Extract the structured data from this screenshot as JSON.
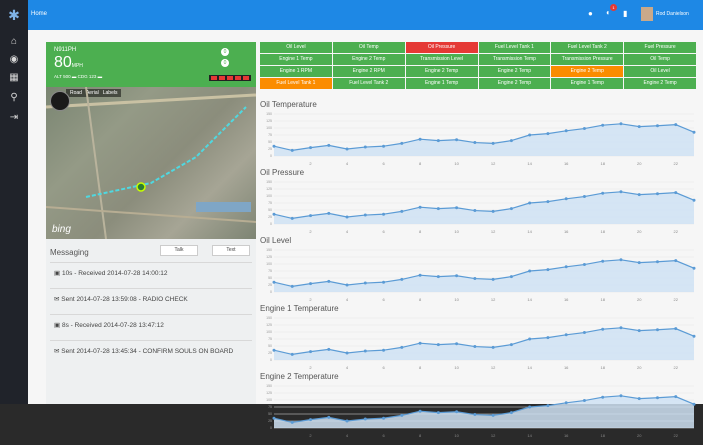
{
  "nav": {
    "home_label": "Home",
    "user_name": "Rod Danielson",
    "notif_count": "1"
  },
  "aircraft": {
    "tail": "N911PH",
    "speed": "80",
    "speed_unit": "MPH",
    "alt_line": "ALT 500 ▬ CDG 123 ▬",
    "stepper_top": "0",
    "stepper_bottom": "0"
  },
  "map": {
    "types": [
      "Road",
      "Aerial",
      "Labels"
    ],
    "brand": "bing"
  },
  "messaging": {
    "title": "Messaging",
    "talk_label": "Talk",
    "text_label": "Text",
    "items": [
      "10s - Received 2014-07-28 14:00:12",
      "Sent 2014-07-28 13:59:08 - RADIO CHECK",
      "8s - Received 2014-07-28 13:47:12",
      "Sent 2014-07-28 13:45:34 - CONFIRM SOULS ON BOARD"
    ]
  },
  "sensors": [
    {
      "label": "Oil Level",
      "status": "ok"
    },
    {
      "label": "Oil Temp",
      "status": "ok"
    },
    {
      "label": "Oil Pressure",
      "status": "alarm"
    },
    {
      "label": "Fuel Level Tank 1",
      "status": "ok"
    },
    {
      "label": "Fuel Level Tank 2",
      "status": "ok"
    },
    {
      "label": "Fuel Pressure",
      "status": "ok"
    },
    {
      "label": "Engine 1 Temp",
      "status": "ok"
    },
    {
      "label": "Engine 2 Temp",
      "status": "ok"
    },
    {
      "label": "Transmission Level",
      "status": "ok"
    },
    {
      "label": "Transmission Temp",
      "status": "ok"
    },
    {
      "label": "Transmission Pressure",
      "status": "ok"
    },
    {
      "label": "Oil Temp",
      "status": "ok"
    },
    {
      "label": "Engine 1 RPM",
      "status": "ok"
    },
    {
      "label": "Engine 2 RPM",
      "status": "ok"
    },
    {
      "label": "Engine 2 Temp",
      "status": "ok"
    },
    {
      "label": "Engine 2 Temp",
      "status": "ok"
    },
    {
      "label": "Engine 2 Temp",
      "status": "warn"
    },
    {
      "label": "Oil Level",
      "status": "ok"
    },
    {
      "label": "Fuel Level Tank 1",
      "status": "warn"
    },
    {
      "label": "Fuel Level Tank 2",
      "status": "ok"
    },
    {
      "label": "Engine 1 Temp",
      "status": "ok"
    },
    {
      "label": "Engine 2 Temp",
      "status": "ok"
    },
    {
      "label": "Engine 1 Temp",
      "status": "ok"
    },
    {
      "label": "Engine 2 Temp",
      "status": "ok"
    }
  ],
  "colors": {
    "ok": "#4caf50",
    "alarm": "#e53935",
    "warn": "#fb8c00",
    "line": "#5b9bd5",
    "fill": "#cfe2f3",
    "topbar": "#1e88e5"
  },
  "chart_data": [
    {
      "type": "area",
      "title": "Oil Temperature",
      "x": [
        0,
        1,
        2,
        3,
        4,
        5,
        6,
        7,
        8,
        9,
        10,
        11,
        12,
        13,
        14,
        15,
        16,
        17,
        18,
        19,
        20,
        21,
        22,
        23
      ],
      "values": [
        35,
        20,
        30,
        38,
        25,
        32,
        35,
        45,
        60,
        55,
        58,
        48,
        45,
        55,
        75,
        80,
        90,
        98,
        110,
        115,
        105,
        108,
        112,
        85
      ],
      "xticks": [
        2,
        4,
        6,
        8,
        10,
        12,
        14,
        16,
        18,
        20,
        22
      ],
      "yticks": [
        0,
        25,
        50,
        75,
        100,
        125,
        150
      ],
      "ylim": [
        0,
        150
      ]
    },
    {
      "type": "area",
      "title": "Oil Pressure",
      "x": [
        0,
        1,
        2,
        3,
        4,
        5,
        6,
        7,
        8,
        9,
        10,
        11,
        12,
        13,
        14,
        15,
        16,
        17,
        18,
        19,
        20,
        21,
        22,
        23
      ],
      "values": [
        35,
        20,
        30,
        38,
        25,
        32,
        35,
        45,
        60,
        55,
        58,
        48,
        45,
        55,
        75,
        80,
        90,
        98,
        110,
        115,
        105,
        108,
        112,
        85
      ],
      "xticks": [
        2,
        4,
        6,
        8,
        10,
        12,
        14,
        16,
        18,
        20,
        22
      ],
      "yticks": [
        0,
        25,
        50,
        75,
        100,
        125,
        150
      ],
      "ylim": [
        0,
        150
      ]
    },
    {
      "type": "area",
      "title": "Oil Level",
      "x": [
        0,
        1,
        2,
        3,
        4,
        5,
        6,
        7,
        8,
        9,
        10,
        11,
        12,
        13,
        14,
        15,
        16,
        17,
        18,
        19,
        20,
        21,
        22,
        23
      ],
      "values": [
        35,
        20,
        30,
        38,
        25,
        32,
        35,
        45,
        60,
        55,
        58,
        48,
        45,
        55,
        75,
        80,
        90,
        98,
        110,
        115,
        105,
        108,
        112,
        85
      ],
      "xticks": [
        2,
        4,
        6,
        8,
        10,
        12,
        14,
        16,
        18,
        20,
        22
      ],
      "yticks": [
        0,
        25,
        50,
        75,
        100,
        125,
        150
      ],
      "ylim": [
        0,
        150
      ]
    },
    {
      "type": "area",
      "title": "Engine 1 Temperature",
      "x": [
        0,
        1,
        2,
        3,
        4,
        5,
        6,
        7,
        8,
        9,
        10,
        11,
        12,
        13,
        14,
        15,
        16,
        17,
        18,
        19,
        20,
        21,
        22,
        23
      ],
      "values": [
        35,
        20,
        30,
        38,
        25,
        32,
        35,
        45,
        60,
        55,
        58,
        48,
        45,
        55,
        75,
        80,
        90,
        98,
        110,
        115,
        105,
        108,
        112,
        85
      ],
      "xticks": [
        2,
        4,
        6,
        8,
        10,
        12,
        14,
        16,
        18,
        20,
        22
      ],
      "yticks": [
        0,
        25,
        50,
        75,
        100,
        125,
        150
      ],
      "ylim": [
        0,
        150
      ]
    },
    {
      "type": "area",
      "title": "Engine 2 Temperature",
      "x": [
        0,
        1,
        2,
        3,
        4,
        5,
        6,
        7,
        8,
        9,
        10,
        11,
        12,
        13,
        14,
        15,
        16,
        17,
        18,
        19,
        20,
        21,
        22,
        23
      ],
      "values": [
        35,
        20,
        30,
        38,
        25,
        32,
        35,
        45,
        60,
        55,
        58,
        48,
        45,
        55,
        75,
        80,
        90,
        98,
        110,
        115,
        105,
        108,
        112,
        85
      ],
      "xticks": [
        2,
        4,
        6,
        8,
        10,
        12,
        14,
        16,
        18,
        20,
        22
      ],
      "yticks": [
        0,
        25,
        50,
        75,
        100,
        125,
        150
      ],
      "ylim": [
        0,
        150
      ]
    }
  ]
}
